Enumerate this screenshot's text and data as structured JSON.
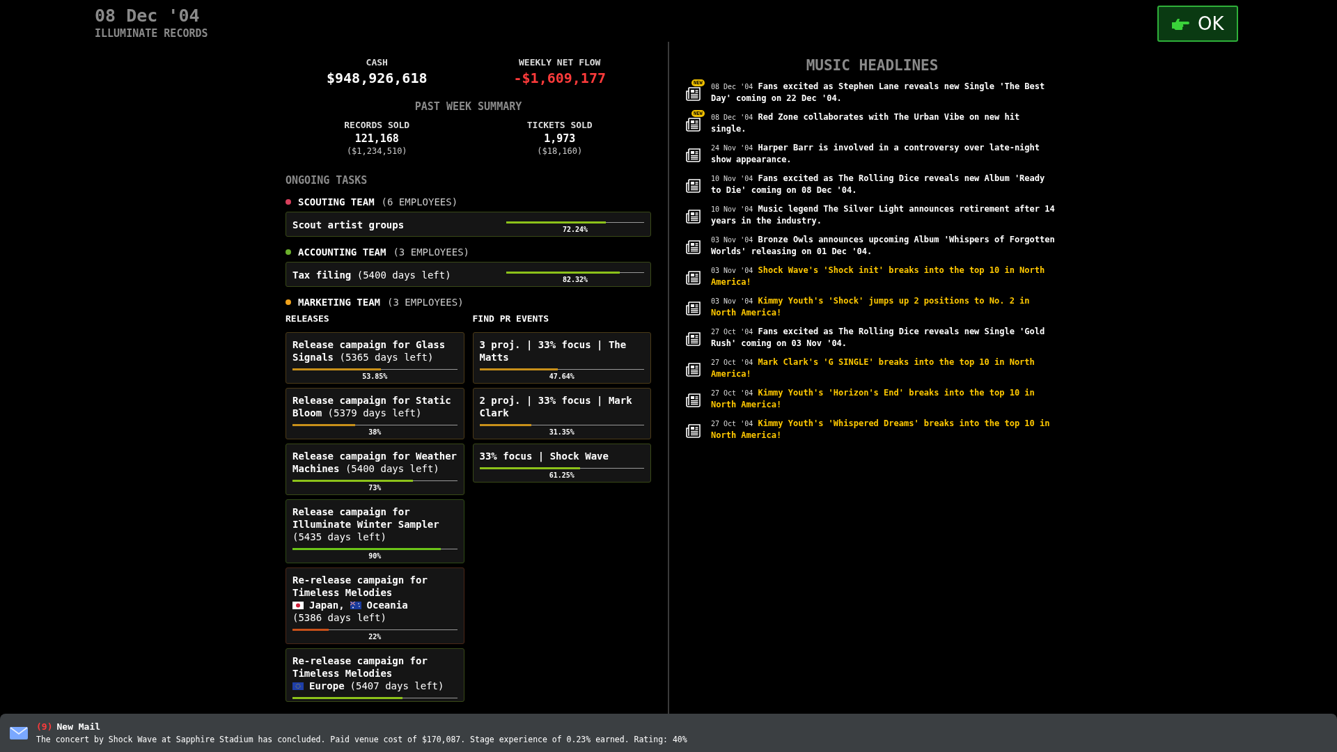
{
  "header": {
    "date": "08 Dec '04",
    "company": "ILLUMINATE RECORDS"
  },
  "ok_button": {
    "label": "OK"
  },
  "finances": [
    {
      "label": "CASH",
      "value": "$948,926,618",
      "negative": false
    },
    {
      "label": "WEEKLY NET FLOW",
      "value": "-$1,609,177",
      "negative": true
    }
  ],
  "past_week": {
    "title": "PAST WEEK SUMMARY",
    "stats": [
      {
        "label": "RECORDS SOLD",
        "value": "121,168",
        "revenue": "($1,234,510)"
      },
      {
        "label": "TICKETS SOLD",
        "value": "1,973",
        "revenue": "($18,160)"
      }
    ]
  },
  "ongoing_tasks": {
    "title": "ONGOING TASKS",
    "teams": [
      {
        "name": "SCOUTING TEAM",
        "employees": "(6 EMPLOYEES)",
        "color": "#d8405c",
        "tasks": [
          {
            "title": "Scout artist groups",
            "level": 0.7224,
            "percent": "72.24%",
            "color": "#8cc21a"
          }
        ]
      },
      {
        "name": "ACCOUNTING TEAM",
        "employees": "(3 EMPLOYEES)",
        "color": "#6cb02c",
        "tasks": [
          {
            "title": "Tax filing",
            "days": "(5400 days left)",
            "level": 0.8232,
            "percent": "82.32%",
            "color": "#8cc21a"
          }
        ]
      },
      {
        "name": "MARKETING TEAM",
        "employees": "(3 EMPLOYEES)",
        "color": "#f0a21c",
        "columns": [
          {
            "title": "RELEASES",
            "tasks": [
              {
                "title": "Release campaign for Glass Signals",
                "days": "(5365 days left)",
                "level": 0.5385,
                "percent": "53.85%",
                "color": "#c8901a"
              },
              {
                "title": "Release campaign for Static Bloom",
                "days": "(5379 days left)",
                "level": 0.38,
                "percent": "38%",
                "color": "#c8901a"
              },
              {
                "title": "Release campaign for Weather Machines",
                "days": "(5400 days left)",
                "level": 0.73,
                "percent": "73%",
                "color": "#8cc21a"
              },
              {
                "title": "Release campaign for Illuminate Winter Sampler",
                "days": "(5435 days left)",
                "level": 0.9,
                "percent": "90%",
                "color": "#6cc418"
              },
              {
                "title": "Re-release campaign for Timeless Melodies",
                "regions": [
                  {
                    "kind": "jp",
                    "label": "Japan,"
                  },
                  {
                    "kind": "au",
                    "label": "Oceania"
                  }
                ],
                "days": "(5386 days left)",
                "level": 0.22,
                "percent": "22%",
                "color": "#c8501a"
              },
              {
                "title": "Re-release campaign for Timeless Melodies",
                "regions": [
                  {
                    "kind": "eu",
                    "label": "Europe"
                  }
                ],
                "days": "(5407 days left)",
                "level": 0.67,
                "color": "#8cc21a"
              }
            ]
          },
          {
            "title": "FIND PR EVENTS",
            "tasks": [
              {
                "title": "3 proj. | 33% focus | The Matts",
                "level": 0.4764,
                "percent": "47.64%",
                "color": "#c8901a"
              },
              {
                "title": "2 proj. | 33% focus | Mark Clark",
                "level": 0.3135,
                "percent": "31.35%",
                "color": "#c8901a"
              },
              {
                "title": "33% focus | Shock Wave",
                "level": 0.6125,
                "percent": "61.25%",
                "color": "#8cc21a"
              }
            ]
          }
        ]
      }
    ]
  },
  "headlines": {
    "title": "MUSIC HEADLINES",
    "items": [
      {
        "badge": "NEW",
        "date": "08 Dec '04",
        "text": "Fans excited as Stephen Lane reveals new Single 'The Best Day' coming on 22 Dec '04.",
        "highlight": false
      },
      {
        "badge": "NEW",
        "date": "08 Dec '04",
        "text": "Red Zone collaborates with The Urban Vibe on new hit single.",
        "highlight": false
      },
      {
        "date": "24 Nov '04",
        "text": "Harper Barr is involved in a controversy over late-night show appearance.",
        "highlight": false
      },
      {
        "date": "10 Nov '04",
        "text": "Fans excited as The Rolling Dice reveals new Album 'Ready to Die' coming on 08 Dec '04.",
        "highlight": false
      },
      {
        "date": "10 Nov '04",
        "text": "Music legend The Silver Light announces retirement after 14 years in the industry.",
        "highlight": false
      },
      {
        "date": "03 Nov '04",
        "text": "Bronze Owls announces upcoming Album 'Whispers of Forgotten Worlds' releasing on 01 Dec '04.",
        "highlight": false
      },
      {
        "date": "03 Nov '04",
        "text": "Shock Wave's 'Shock init' breaks into the top 10 in North America!",
        "highlight": true
      },
      {
        "date": "03 Nov '04",
        "text": "Kimmy Youth's 'Shock' jumps up 2 positions to No. 2 in North America!",
        "highlight": true
      },
      {
        "date": "27 Oct '04",
        "text": "Fans excited as The Rolling Dice reveals new Single 'Gold Rush' coming on 03 Nov '04.",
        "highlight": false
      },
      {
        "date": "27 Oct '04",
        "text": "Mark Clark's 'G SINGLE' breaks into the top 10 in North America!",
        "highlight": true
      },
      {
        "date": "27 Oct '04",
        "text": "Kimmy Youth's 'Horizon's End' breaks into the top 10 in North America!",
        "highlight": true
      },
      {
        "date": "27 Oct '04",
        "text": "Kimmy Youth's 'Whispered Dreams' breaks into the top 10 in North America!",
        "highlight": true
      }
    ]
  },
  "mail": {
    "count": "(9)",
    "title": "New Mail",
    "message": "The concert by Shock Wave at Sapphire Stadium has concluded. Paid venue cost of $170,087. Stage experience of 0.23% earned. Rating: 40%"
  }
}
